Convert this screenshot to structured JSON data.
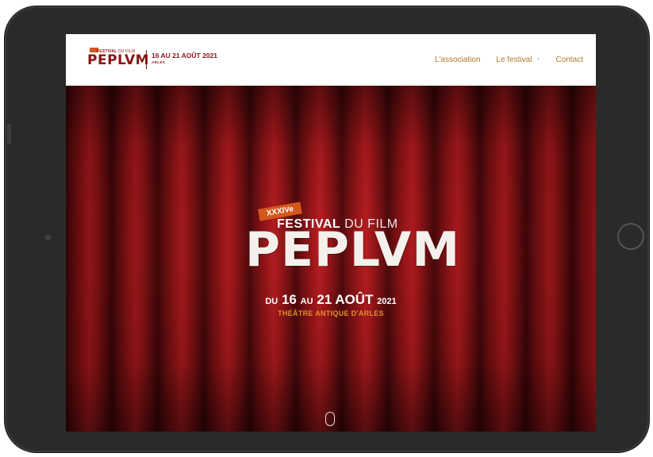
{
  "header": {
    "logo": {
      "small_festival_bold": "FESTIVAL",
      "small_festival_light": "DU FILM",
      "peplum": "PEPLVM",
      "dates": "16 AU 21 AOÛT 2021",
      "city": "ARLES"
    },
    "nav": [
      {
        "label": "L'association"
      },
      {
        "label": "Le festival",
        "chevron": "˅"
      },
      {
        "label": "Contact"
      }
    ]
  },
  "hero": {
    "badge": "XXXIVe",
    "festival_bold": "FESTIVAL",
    "festival_light": "DU FILM",
    "title": "PEPLVM",
    "dates_du": "DU",
    "dates_start": "16",
    "dates_au": "AU",
    "dates_end": "21 AOÛT",
    "dates_year": "2021",
    "venue": "THÉÂTRE ANTIQUE D'ARLES"
  },
  "colors": {
    "brand_red": "#8a1414",
    "nav_gold": "#b07a2a",
    "badge_orange": "#d4571b",
    "venue_orange": "#e0912d",
    "curtain_red": "#9a1418"
  },
  "icons": {
    "scroll": "scroll-down-icon",
    "chevron": "chevron-down-icon"
  }
}
